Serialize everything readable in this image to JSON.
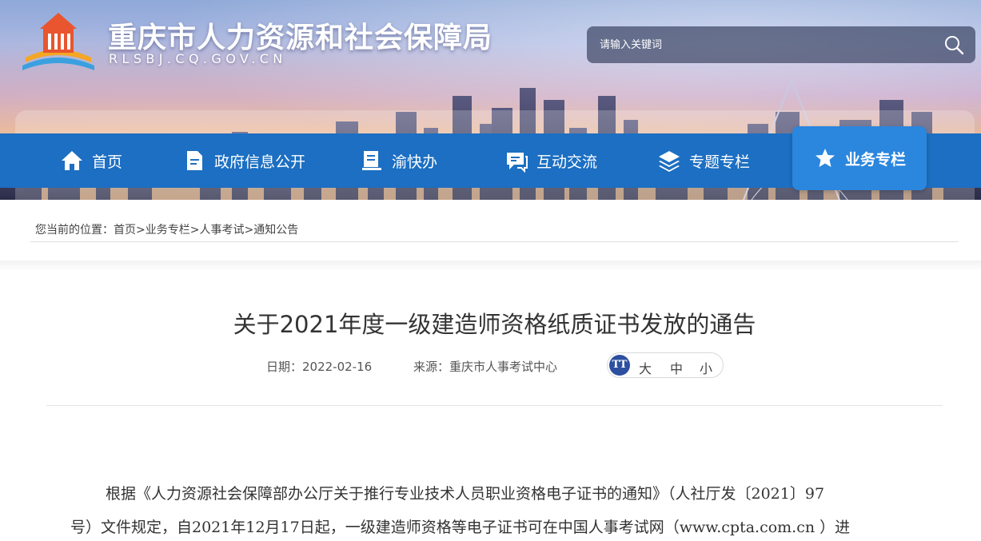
{
  "header": {
    "site_title": "重庆市人力资源和社会保障局",
    "site_domain": "RLSBJ.CQ.GOV.CN",
    "logo_icon": "government-building-logo",
    "search": {
      "placeholder": "请输入关键词",
      "icon": "search-icon"
    }
  },
  "nav": {
    "items": [
      {
        "label": "首页",
        "icon": "home-icon"
      },
      {
        "label": "政府信息公开",
        "icon": "document-icon"
      },
      {
        "label": "渝快办",
        "icon": "book-icon"
      },
      {
        "label": "互动交流",
        "icon": "chat-icon"
      },
      {
        "label": "专题专栏",
        "icon": "layers-icon"
      },
      {
        "label": "业务专栏",
        "icon": "star-icon",
        "active": true
      }
    ],
    "colors": {
      "bar": "#1c6fc2",
      "active": "#2b86de"
    }
  },
  "breadcrumb": {
    "prefix": "您当前的位置：",
    "items": [
      "首页",
      "业务专栏",
      "人事考试",
      "通知公告"
    ],
    "separator": ">"
  },
  "article": {
    "title": "关于2021年度一级建造师资格纸质证书发放的通告",
    "date_label": "日期：2022-02-16",
    "source_label": "来源：重庆市人事考试中心",
    "font_size": {
      "icon_text": "TT",
      "large": "大",
      "medium": "中",
      "small": "小"
    },
    "paragraph_lines": [
      "根据《人力资源社会保障部办公厅关于推行专业技术人员职业资格电子证书的通知》（人社厅发〔2021〕97",
      "号）文件规定，自2021年12月17日起，一级建造师资格等电子证书可在中国人事考试网（www.cpta.com.cn ）进"
    ]
  }
}
